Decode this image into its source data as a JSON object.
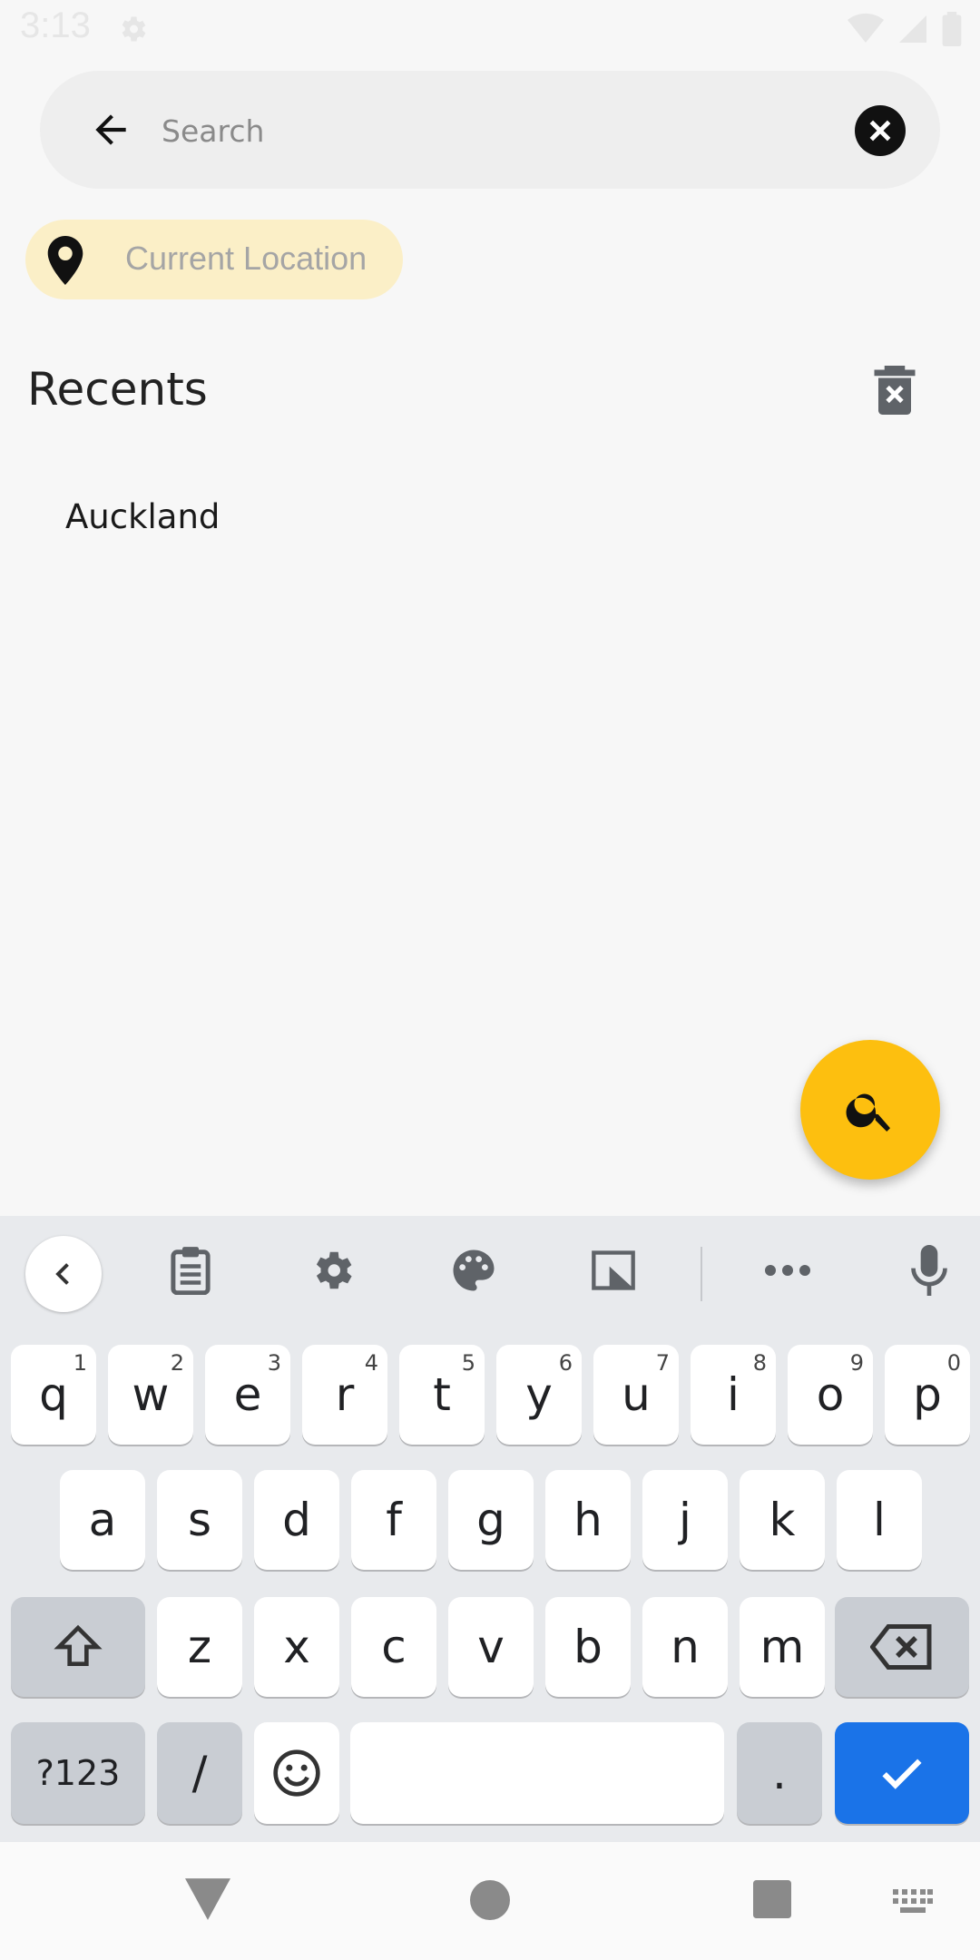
{
  "status_bar": {
    "time": "3:13"
  },
  "search": {
    "placeholder": "Search",
    "value": ""
  },
  "location_chip": {
    "label": "Current Location"
  },
  "recents": {
    "title": "Recents",
    "items": [
      "Auckland"
    ]
  },
  "keyboard": {
    "row1": [
      {
        "key": "q",
        "hint": "1"
      },
      {
        "key": "w",
        "hint": "2"
      },
      {
        "key": "e",
        "hint": "3"
      },
      {
        "key": "r",
        "hint": "4"
      },
      {
        "key": "t",
        "hint": "5"
      },
      {
        "key": "y",
        "hint": "6"
      },
      {
        "key": "u",
        "hint": "7"
      },
      {
        "key": "i",
        "hint": "8"
      },
      {
        "key": "o",
        "hint": "9"
      },
      {
        "key": "p",
        "hint": "0"
      }
    ],
    "row2": [
      "a",
      "s",
      "d",
      "f",
      "g",
      "h",
      "j",
      "k",
      "l"
    ],
    "row3": [
      "z",
      "x",
      "c",
      "v",
      "b",
      "n",
      "m"
    ],
    "symbols_label": "?123",
    "slash_label": "/",
    "period_label": "."
  },
  "colors": {
    "fab": "#fdbf0f",
    "chip_bg": "#fbefc7",
    "enter_key": "#1a73e8"
  }
}
